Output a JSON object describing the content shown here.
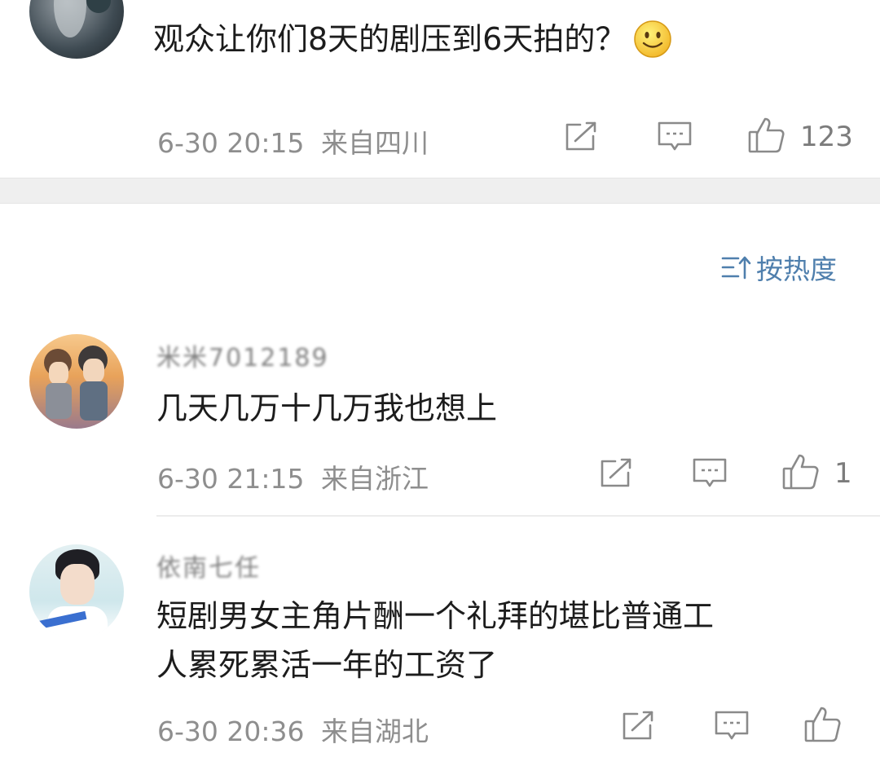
{
  "comments": [
    {
      "name": "",
      "text": "观众让你们8天的剧压到6天拍的？",
      "emoji": "slightly-smiling-face",
      "time": "6-30 20:15",
      "location": "来自四川",
      "likes": "123"
    },
    {
      "name": "米米7012189",
      "text": "几天几万十几万我也想上",
      "time": "6-30 21:15",
      "location": "来自浙江",
      "likes": "1"
    },
    {
      "name": "依南七任",
      "text_line1": "短剧男女主角片酬一个礼拜的堪比普通工",
      "text_line2": "人累死累活一年的工资了",
      "time": "6-30 20:36",
      "location": "来自湖北",
      "likes": ""
    }
  ],
  "sort": {
    "label": "按热度",
    "icon": "sort-icon"
  },
  "colors": {
    "accent": "#4f7fad",
    "meta": "#8e8e8e",
    "band": "#efefef"
  }
}
